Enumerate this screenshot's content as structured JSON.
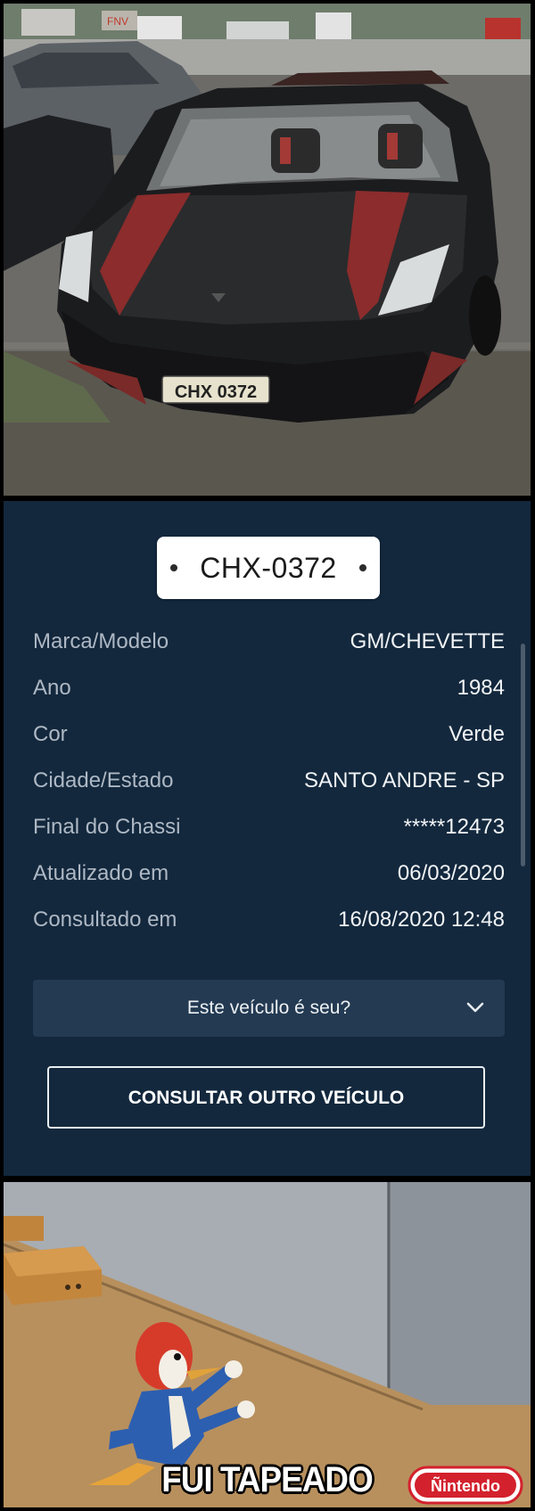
{
  "photo": {
    "car_plate": "CHX 0372",
    "background_sign": "FNV"
  },
  "vehicle": {
    "plate": "CHX-0372",
    "fields": [
      {
        "label": "Marca/Modelo",
        "value": "GM/CHEVETTE"
      },
      {
        "label": "Ano",
        "value": "1984"
      },
      {
        "label": "Cor",
        "value": "Verde"
      },
      {
        "label": "Cidade/Estado",
        "value": "SANTO ANDRE - SP"
      },
      {
        "label": "Final do Chassi",
        "value": "*****12473"
      },
      {
        "label": "Atualizado em",
        "value": "06/03/2020"
      },
      {
        "label": "Consultado em",
        "value": "16/08/2020 12:48"
      }
    ],
    "question": "Este veículo é seu?",
    "consult_button": "CONSULTAR OUTRO VEÍCULO"
  },
  "meme": {
    "caption": "FUI TAPEADO",
    "logo_text": "Ñintendo"
  },
  "colors": {
    "panel_bg": "#13283d",
    "question_bg": "#233a52",
    "label_text": "#aeb8c4",
    "value_text": "#f2f4f6",
    "logo_red": "#d3212d"
  },
  "icons": [
    "chevron-down-icon"
  ]
}
